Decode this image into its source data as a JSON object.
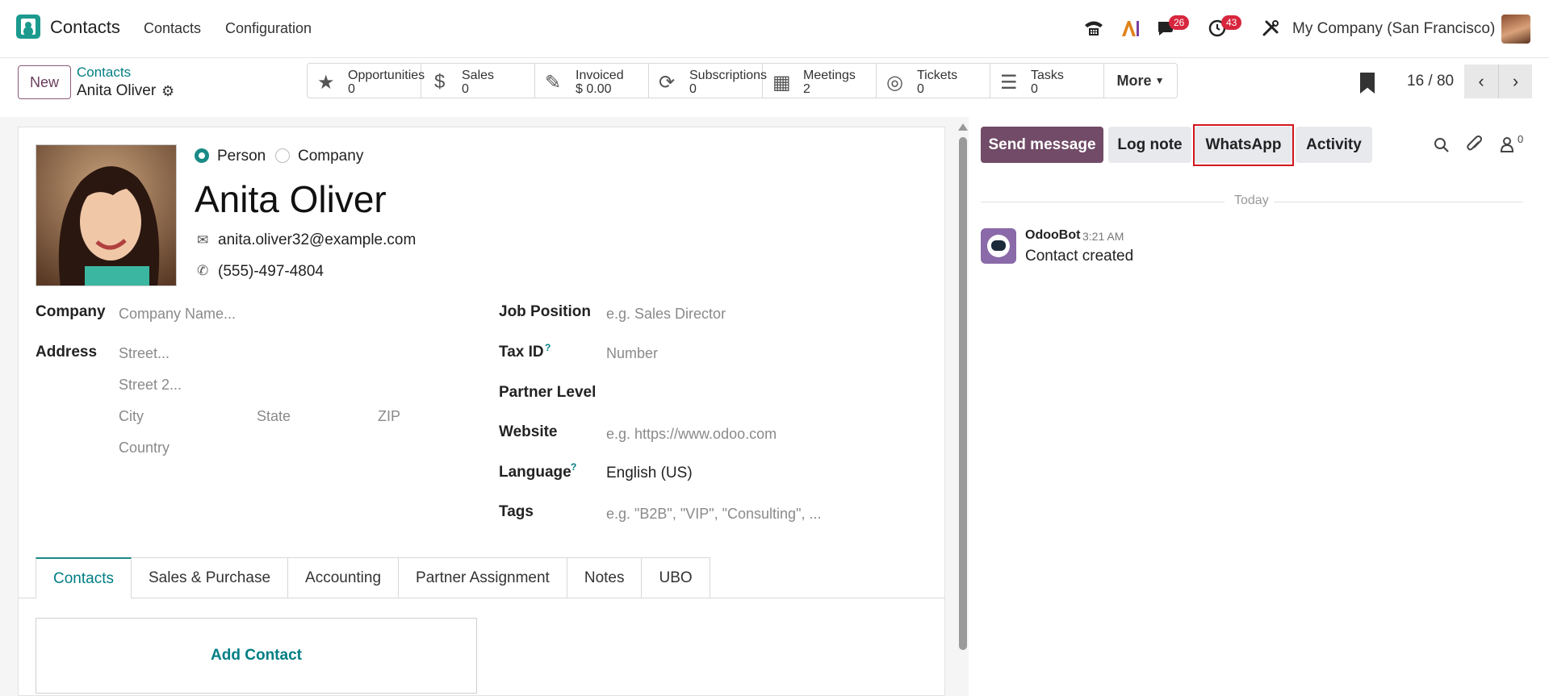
{
  "navbar": {
    "app_title": "Contacts",
    "menus": [
      "Contacts",
      "Configuration"
    ],
    "messages_badge": "26",
    "activities_badge": "43",
    "company": "My Company (San Francisco)"
  },
  "control_panel": {
    "new_label": "New",
    "breadcrumb": "Contacts",
    "record_name": "Anita Oliver",
    "pager": "16 / 80",
    "more_label": "More",
    "smart_buttons": [
      {
        "label": "Opportunities",
        "value": "0",
        "icon": "star-icon"
      },
      {
        "label": "Sales",
        "value": "0",
        "icon": "dollar-icon"
      },
      {
        "label": "Invoiced",
        "value": "$ 0.00",
        "icon": "invoice-icon"
      },
      {
        "label": "Subscriptions",
        "value": "0",
        "icon": "refresh-icon"
      },
      {
        "label": "Meetings",
        "value": "2",
        "icon": "calendar-icon"
      },
      {
        "label": "Tickets",
        "value": "0",
        "icon": "lifebuoy-icon"
      },
      {
        "label": "Tasks",
        "value": "0",
        "icon": "tasks-icon"
      }
    ]
  },
  "form": {
    "type_person": "Person",
    "type_company": "Company",
    "name": "Anita Oliver",
    "email": "anita.oliver32@example.com",
    "phone": "(555)-497-4804",
    "left_fields": {
      "company_label": "Company",
      "company_placeholder": "Company Name...",
      "address_label": "Address",
      "street_placeholder": "Street...",
      "street2_placeholder": "Street 2...",
      "city_placeholder": "City",
      "state_placeholder": "State",
      "zip_placeholder": "ZIP",
      "country_placeholder": "Country"
    },
    "right_fields": {
      "job_label": "Job Position",
      "job_placeholder": "e.g. Sales Director",
      "tax_label": "Tax ID",
      "tax_placeholder": "Number",
      "partner_level_label": "Partner Level",
      "website_label": "Website",
      "website_placeholder": "e.g. https://www.odoo.com",
      "language_label": "Language",
      "language_value": "English (US)",
      "tags_label": "Tags",
      "tags_placeholder": "e.g. \"B2B\", \"VIP\", \"Consulting\", ...",
      "help_mark": "?"
    },
    "tabs": [
      "Contacts",
      "Sales & Purchase",
      "Accounting",
      "Partner Assignment",
      "Notes",
      "UBO"
    ],
    "add_contact": "Add Contact"
  },
  "chatter": {
    "send_message": "Send message",
    "log_note": "Log note",
    "whatsapp": "WhatsApp",
    "activity": "Activity",
    "followers_count": "0",
    "date_separator": "Today",
    "message": {
      "author": "OdooBot",
      "time": "3:21 AM",
      "body": "Contact created"
    }
  },
  "colors": {
    "brand": "#714b67",
    "accent": "#017e84",
    "highlight": "#d1161d"
  }
}
